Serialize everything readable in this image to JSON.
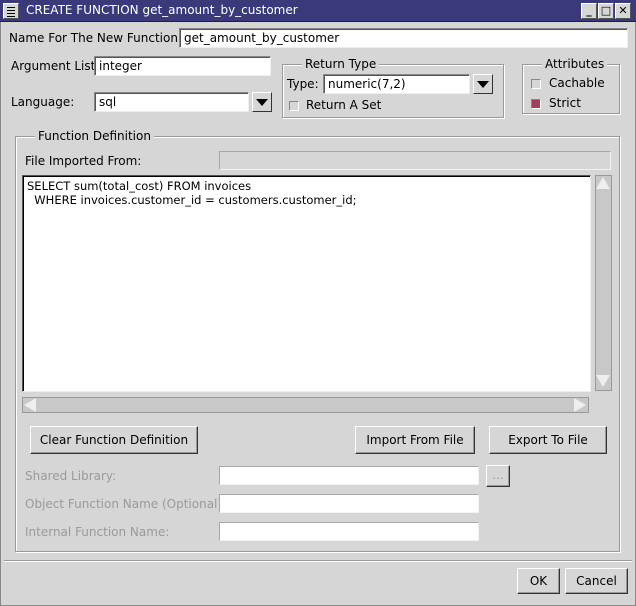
{
  "window": {
    "title": "CREATE FUNCTION get_amount_by_customer",
    "minimize_glyph": "_",
    "maximize_glyph": "□",
    "close_glyph": "✕"
  },
  "name_field": {
    "label": "Name For The New Function:",
    "value": "get_amount_by_customer"
  },
  "argument_list": {
    "label": "Argument List:",
    "value": "integer"
  },
  "language": {
    "label": "Language:",
    "value": "sql"
  },
  "return_type": {
    "title": "Return Type",
    "type_label": "Type:",
    "type_value": "numeric(7,2)",
    "return_set_label": "Return A Set",
    "return_set_checked": false
  },
  "attributes": {
    "title": "Attributes",
    "cachable_label": "Cachable",
    "cachable_checked": false,
    "strict_label": "Strict",
    "strict_checked": true
  },
  "definition": {
    "title": "Function Definition",
    "file_imported_label": "File Imported From:",
    "file_imported_value": "",
    "code": "SELECT sum(total_cost) FROM invoices\n  WHERE invoices.customer_id = customers.customer_id;",
    "clear_button": "Clear Function Definition",
    "import_button": "Import From File",
    "export_button": "Export To File"
  },
  "shared_library": {
    "label": "Shared Library:",
    "value": "",
    "browse": "..."
  },
  "object_function_name": {
    "label": "Object Function Name (Optional):",
    "value": ""
  },
  "internal_function_name": {
    "label": "Internal Function Name:",
    "value": ""
  },
  "footer": {
    "ok": "OK",
    "cancel": "Cancel"
  },
  "colors": {
    "titlebar": "#3a3a7a",
    "dialog": "#d6d6d6",
    "strict_check": "#a0405a"
  }
}
